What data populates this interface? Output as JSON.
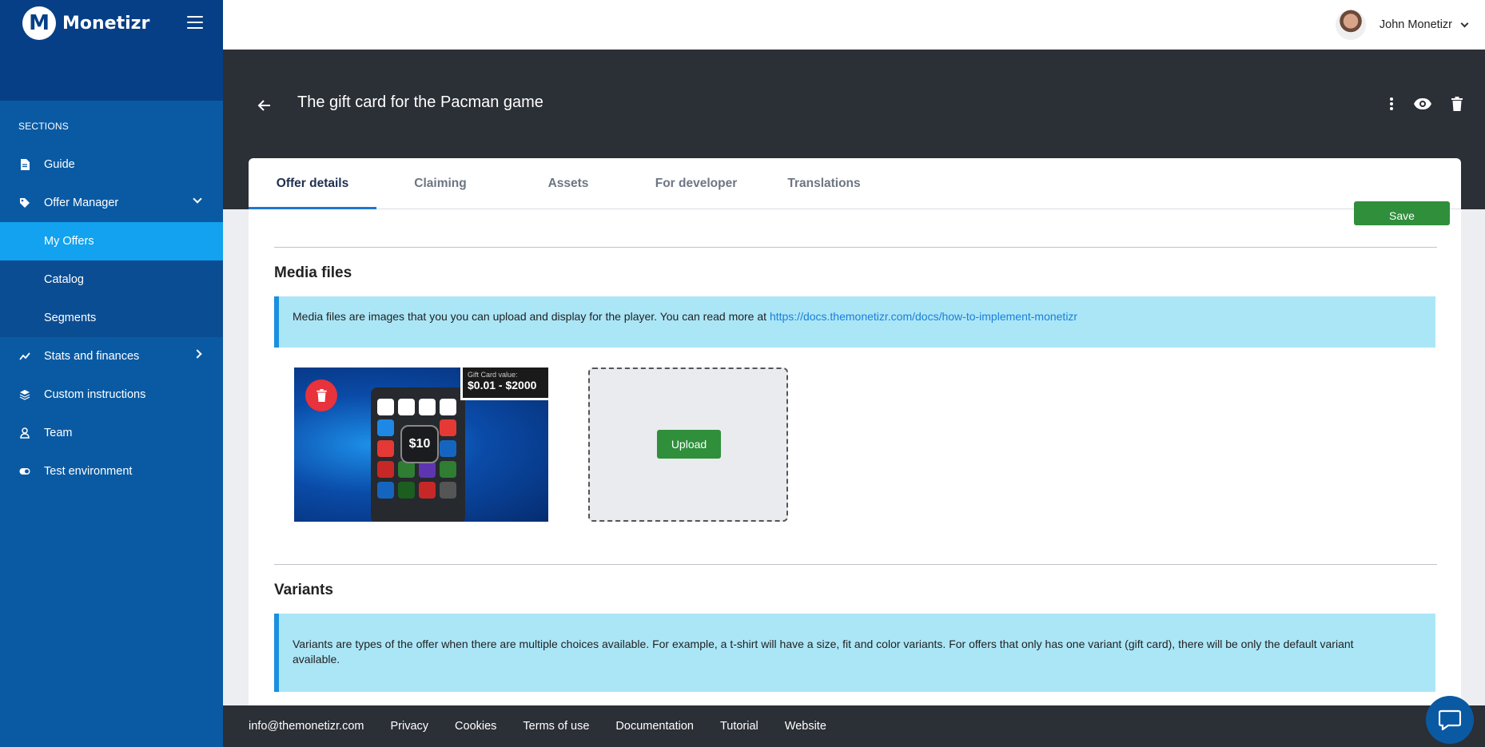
{
  "brand": {
    "name": "Monetizr",
    "logo_letter": "M"
  },
  "sidebar": {
    "section_label": "SECTIONS",
    "items": [
      {
        "label": "Guide",
        "icon": "document-icon"
      },
      {
        "label": "Offer Manager",
        "icon": "tag-icon",
        "expanded": true,
        "children": [
          {
            "label": "My Offers",
            "active": true
          },
          {
            "label": "Catalog"
          },
          {
            "label": "Segments"
          }
        ]
      },
      {
        "label": "Stats and finances",
        "icon": "chart-line-icon"
      },
      {
        "label": "Custom instructions",
        "icon": "layers-icon"
      },
      {
        "label": "Team",
        "icon": "user-icon"
      },
      {
        "label": "Test environment",
        "icon": "toggle-icon"
      }
    ]
  },
  "header": {
    "user_name": "John Monetizr"
  },
  "page": {
    "title": "The gift card for the Pacman game"
  },
  "tabs": [
    {
      "label": "Offer details",
      "active": true
    },
    {
      "label": "Claiming"
    },
    {
      "label": "Assets"
    },
    {
      "label": "For developer"
    },
    {
      "label": "Translations"
    }
  ],
  "save_label": "Save",
  "media": {
    "title": "Media files",
    "info_text": "Media files are images that you you can upload and display for the player. You can read more at ",
    "info_link": "https://docs.themonetizr.com/docs/how-to-implement-monetizr",
    "image": {
      "tag_small": "Gift Card value:",
      "tag_big": "$0.01 - $2000",
      "center_value": "$10"
    },
    "upload_label": "Upload"
  },
  "variants": {
    "title": "Variants",
    "info_text": "Variants are types of the offer when there are multiple choices available. For example, a t-shirt will have a size, fit and color variants. For offers that only has one variant (gift card), there will be only the default variant available."
  },
  "footer": {
    "links": [
      "info@themonetizr.com",
      "Privacy",
      "Cookies",
      "Terms of use",
      "Documentation",
      "Tutorial",
      "Website"
    ]
  },
  "colors": {
    "sidebar": "#0a5aa3",
    "active_item": "#12a2ef",
    "primary_button": "#2f8f3b",
    "info_bg": "#abe6f7"
  }
}
